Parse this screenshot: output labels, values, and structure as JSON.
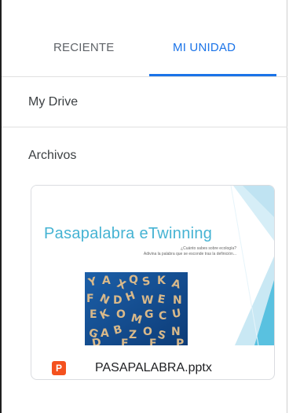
{
  "tabs": [
    {
      "label": "RECIENTE"
    },
    {
      "label": "MI UNIDAD",
      "active": true
    }
  ],
  "my_drive": {
    "label": "My Drive"
  },
  "files_section": {
    "label": "Archivos"
  },
  "file": {
    "name": "PASAPALABRA.pptx",
    "type_icon": "P",
    "thumbnail": {
      "title": "Pasapalabra eTwinning",
      "subtitle_line1": "¿Cuánto sabes sobre ecología?",
      "subtitle_line2": "Adivina la palabra que se esconde tras la definición..."
    }
  },
  "colors": {
    "accent": "#1a73e8",
    "thumb_title": "#45b3d3",
    "ppt_icon": "#f4511e"
  }
}
